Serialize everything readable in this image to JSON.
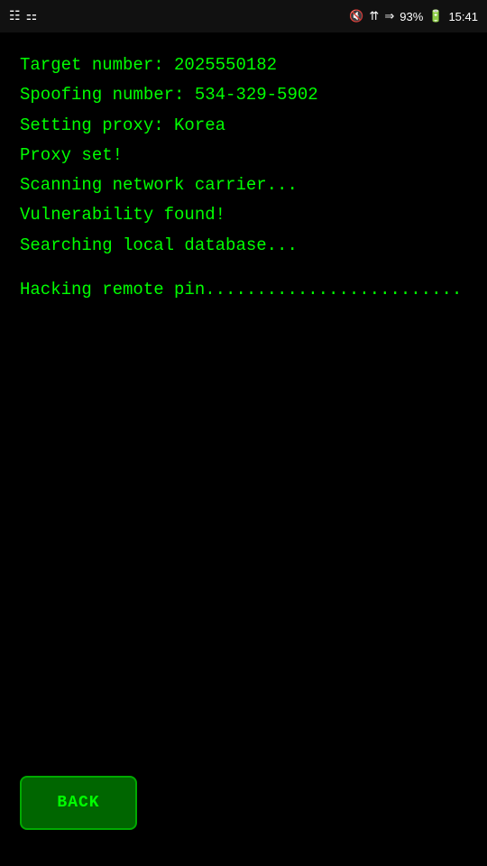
{
  "statusBar": {
    "time": "15:41",
    "battery": "93%",
    "icons": {
      "mute": "🔇",
      "wifi": "wifi-icon",
      "signal": "signal-icon",
      "battery": "battery-icon"
    }
  },
  "terminal": {
    "lines": [
      "Target number: 2025550182",
      "Spoofing number: 534-329-5902",
      "Setting proxy: Korea",
      "Proxy set!",
      "Scanning network carrier...",
      "Vulnerability found!",
      "Searching local database...",
      "",
      "Hacking remote pin........................."
    ]
  },
  "backButton": {
    "label": "BACK"
  }
}
